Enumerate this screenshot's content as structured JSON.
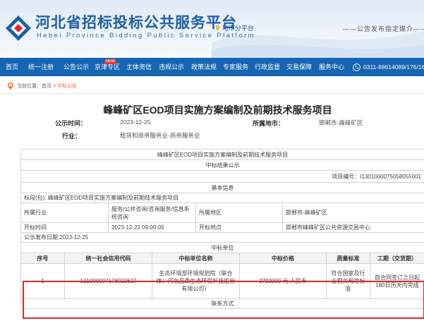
{
  "header": {
    "title": "河北省招标投标公共服务平台",
    "subtitle": "Hebei Province Bidding Public Service Platform",
    "city_label": "地市分平台",
    "slogan": "——公告发布指定媒介——"
  },
  "nav": {
    "items": [
      "首页",
      "统一注册",
      "公告公示",
      "京津专区",
      "主体资信",
      "违规公示",
      "政策法规",
      "专家服务",
      "行政监督",
      "交易保障",
      "服务中心"
    ],
    "badge": "NEW",
    "phone": "0311-88614089/176/165"
  },
  "breadcrumb": {
    "prefix": "当前位置：",
    "home": "首页",
    "separator": " > ",
    "current": "中标公告"
  },
  "article": {
    "title": "峰峰矿区EOD项目实施方案编制及前期技术服务项目",
    "publish_time_label": "公示时间：",
    "publish_time": "2023-12-25",
    "region_label": "所属地市：",
    "region": "邯郸市-峰峰矿区",
    "industry_label": "行业：",
    "industry": "租赁和商务服务业-商务服务业"
  },
  "table": {
    "project_title": "峰峰矿区EOD项目实施方案编制及前期技术服务项目",
    "notice_title": "中标结果公示",
    "project_no": "项目编号：I1301000075058055001",
    "basic_info_title": "基本信息",
    "section": "标段(包): 峰峰矿区EOD项目实施方案编制及前期技术服务项目",
    "industry_label": "所属行业",
    "industry_value": "服务/公共咨询/咨询服务/信息系统咨询",
    "area_label": "所属地区",
    "area_value": "邯郸市-峰峰矿区",
    "open_time_label": "开标时间",
    "open_time_value": "2023-12-21 09:00:00",
    "open_place_label": "开标地点",
    "open_place_value": "邯郸市峰峰矿区公共资源交易中心",
    "publish_date": "公示发布日期:2023-12-25",
    "winner_title": "中标单位",
    "columns": [
      "序号",
      "统一社会信用代码",
      "中标单位名称",
      "中标价格",
      "质量标准",
      "工期（交货期）"
    ],
    "rows": [
      {
        "no": "1",
        "credit_code": "121000007178022627",
        "name": "生态环境部环境规划院（联合体：河北晶森生态环保科技股份有限公司）",
        "price": "2792000 元 人民币",
        "quality": "符合国家及行业相关规范标准",
        "period": "自合同签订之日起180日历天内完成"
      }
    ],
    "contact_title": "联系方式"
  },
  "colors": {
    "brand_blue": "#1565b3",
    "title_blue": "#1f5fa6",
    "highlight_red": "#e4252c",
    "breadcrumb_orange": "#e86a2c"
  }
}
